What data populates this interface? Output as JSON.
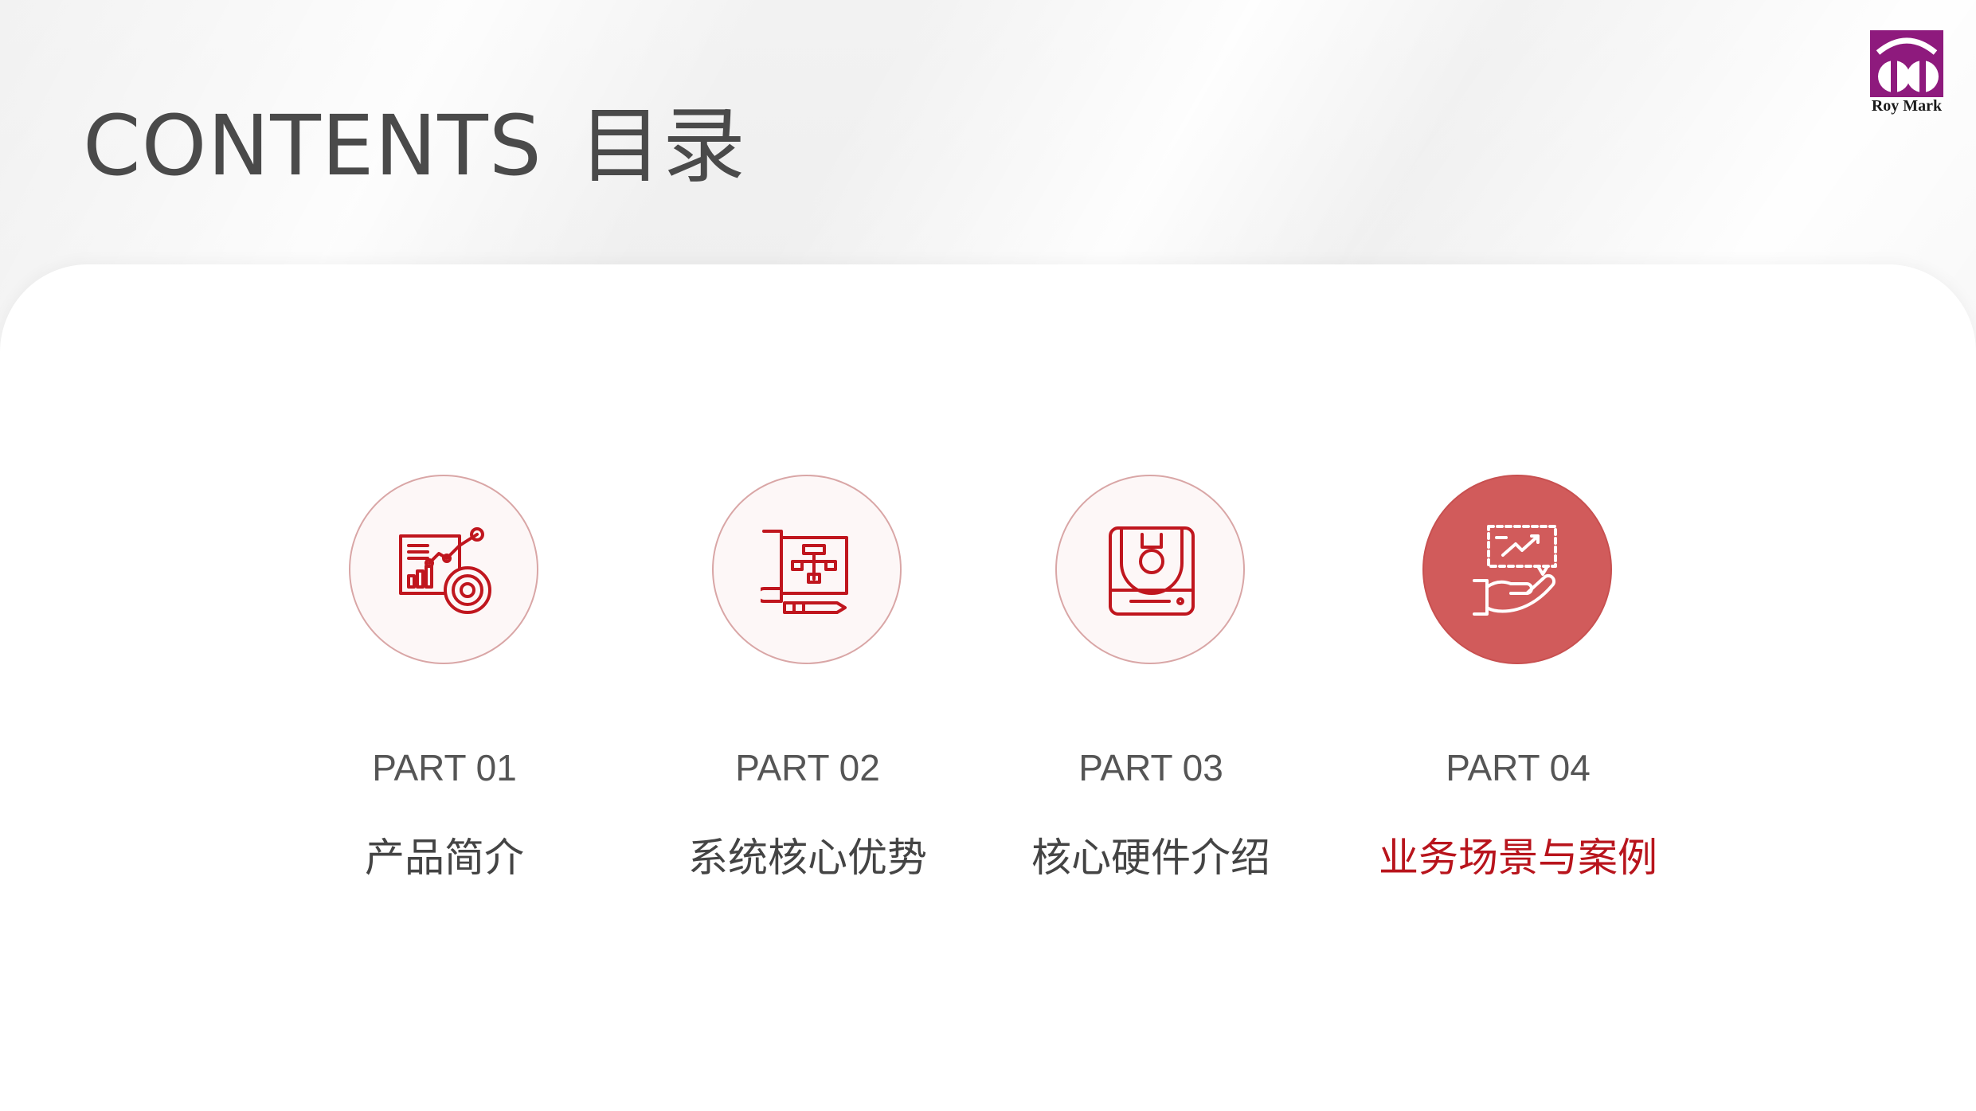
{
  "title": {
    "en": "CONTENTS",
    "cn": "目录"
  },
  "logo": {
    "text": "Roy Mark",
    "color": "#8e1a7d"
  },
  "accent_color": "#b8141c",
  "items": [
    {
      "part": "PART 01",
      "label": "产品简介",
      "icon": "analytics-chart-icon",
      "active": false
    },
    {
      "part": "PART 02",
      "label": "系统核心优势",
      "icon": "blueprint-flowchart-icon",
      "active": false
    },
    {
      "part": "PART 03",
      "label": "核心硬件介绍",
      "icon": "hardware-device-icon",
      "active": false
    },
    {
      "part": "PART 04",
      "label": "业务场景与案例",
      "icon": "hand-presentation-icon",
      "active": true
    }
  ]
}
